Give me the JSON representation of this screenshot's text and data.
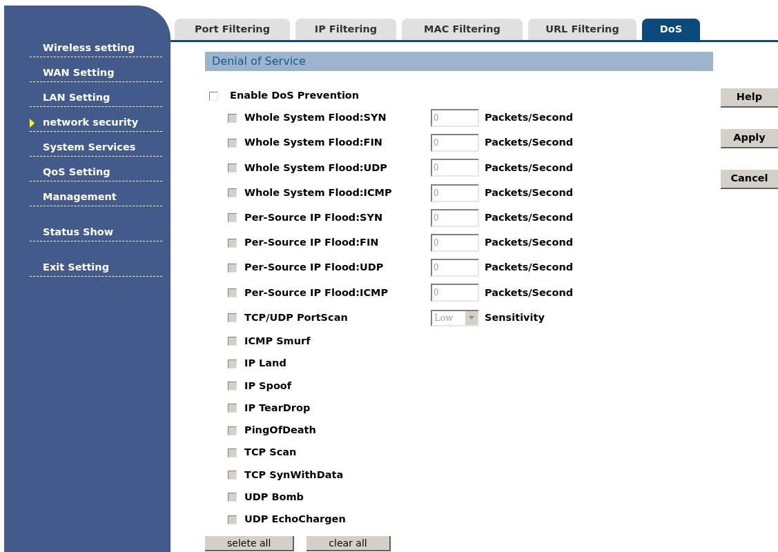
{
  "sidebar": {
    "sections": [
      {
        "items": [
          {
            "label": "Wireless setting",
            "selected": false
          },
          {
            "label": "WAN Setting",
            "selected": false
          },
          {
            "label": "LAN Setting",
            "selected": false
          },
          {
            "label": "network security",
            "selected": true
          },
          {
            "label": "System Services",
            "selected": false
          },
          {
            "label": "QoS Setting",
            "selected": false
          },
          {
            "label": "Management",
            "selected": false
          }
        ]
      },
      {
        "items": [
          {
            "label": "Status Show",
            "selected": false
          }
        ]
      },
      {
        "items": [
          {
            "label": "Exit Setting",
            "selected": false
          }
        ]
      }
    ]
  },
  "tabs": [
    {
      "label": "Port Filtering",
      "selected": false
    },
    {
      "label": "IP Filtering",
      "selected": false
    },
    {
      "label": "MAC Filtering",
      "selected": false
    },
    {
      "label": "URL Filtering",
      "selected": false
    },
    {
      "label": "DoS",
      "selected": true
    }
  ],
  "section_title": "Denial of Service",
  "enable": {
    "label": "Enable DoS Prevention",
    "checked": false
  },
  "options": [
    {
      "kind": "rate",
      "label": "Whole System Flood:SYN",
      "checked": false,
      "disabled": true,
      "value": "0",
      "unit": "Packets/Second"
    },
    {
      "kind": "rate",
      "label": "Whole System Flood:FIN",
      "checked": false,
      "disabled": true,
      "value": "0",
      "unit": "Packets/Second"
    },
    {
      "kind": "rate",
      "label": "Whole System Flood:UDP",
      "checked": false,
      "disabled": true,
      "value": "0",
      "unit": "Packets/Second"
    },
    {
      "kind": "rate",
      "label": "Whole System Flood:ICMP",
      "checked": false,
      "disabled": true,
      "value": "0",
      "unit": "Packets/Second"
    },
    {
      "kind": "rate",
      "label": "Per-Source IP Flood:SYN",
      "checked": false,
      "disabled": true,
      "value": "0",
      "unit": "Packets/Second"
    },
    {
      "kind": "rate",
      "label": "Per-Source IP Flood:FIN",
      "checked": false,
      "disabled": true,
      "value": "0",
      "unit": "Packets/Second"
    },
    {
      "kind": "rate",
      "label": "Per-Source IP Flood:UDP",
      "checked": false,
      "disabled": true,
      "value": "0",
      "unit": "Packets/Second"
    },
    {
      "kind": "rate",
      "label": "Per-Source IP Flood:ICMP",
      "checked": false,
      "disabled": true,
      "value": "0",
      "unit": "Packets/Second"
    },
    {
      "kind": "select",
      "label": "TCP/UDP PortScan",
      "checked": false,
      "disabled": true,
      "value": "Low",
      "unit": "Sensitivity"
    },
    {
      "kind": "plain",
      "label": "ICMP Smurf",
      "checked": false,
      "disabled": true
    },
    {
      "kind": "plain",
      "label": "IP Land",
      "checked": false,
      "disabled": true
    },
    {
      "kind": "plain",
      "label": "IP Spoof",
      "checked": false,
      "disabled": true
    },
    {
      "kind": "plain",
      "label": "IP TearDrop",
      "checked": false,
      "disabled": true
    },
    {
      "kind": "plain",
      "label": "PingOfDeath",
      "checked": false,
      "disabled": true
    },
    {
      "kind": "plain",
      "label": "TCP Scan",
      "checked": false,
      "disabled": true
    },
    {
      "kind": "plain",
      "label": "TCP SynWithData",
      "checked": false,
      "disabled": true
    },
    {
      "kind": "plain",
      "label": "UDP Bomb",
      "checked": false,
      "disabled": true
    },
    {
      "kind": "plain",
      "label": "UDP EchoChargen",
      "checked": false,
      "disabled": true
    }
  ],
  "bottom_buttons": [
    "selete all",
    "clear all"
  ],
  "side_buttons": [
    "Help",
    "Apply",
    "Cancel"
  ]
}
